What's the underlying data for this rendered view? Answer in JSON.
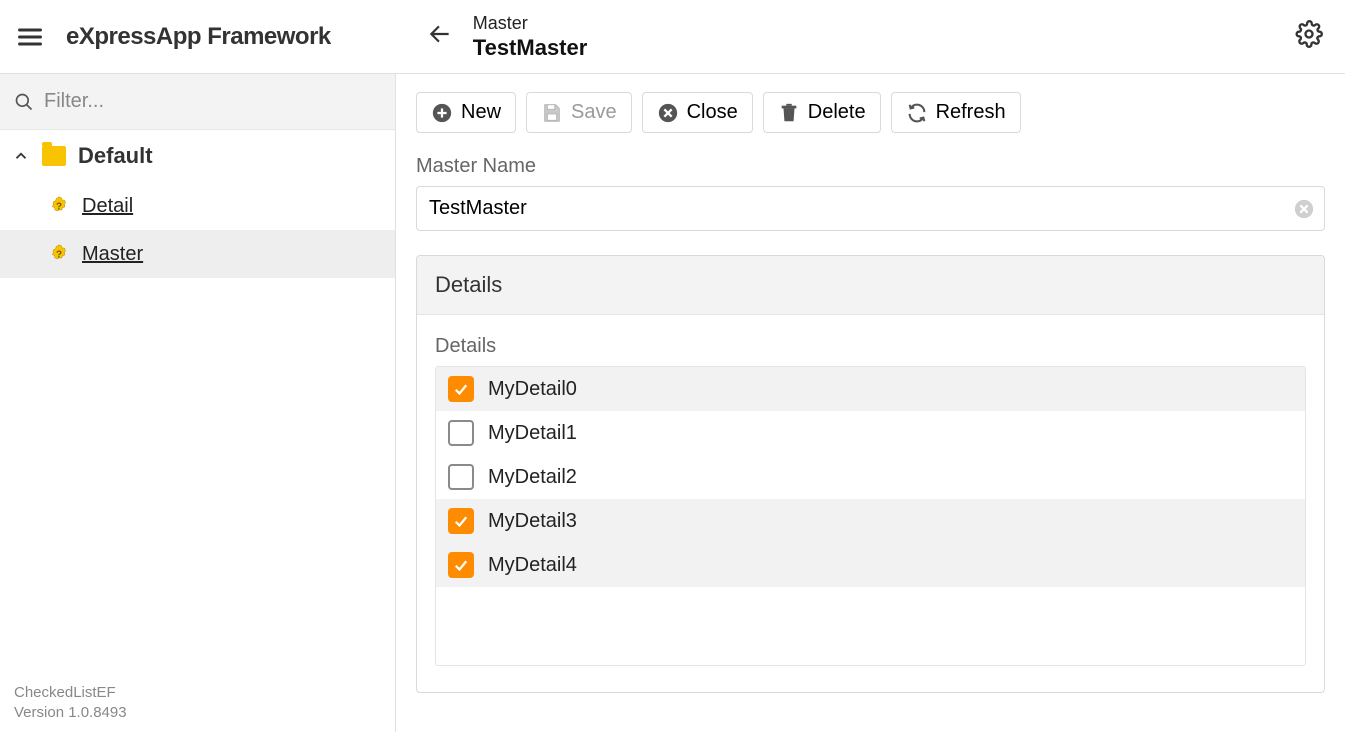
{
  "app": {
    "title": "eXpressApp Framework"
  },
  "breadcrumb": {
    "parent": "Master",
    "current": "TestMaster"
  },
  "sidebar": {
    "filter_placeholder": "Filter...",
    "group": "Default",
    "items": [
      {
        "label": "Detail",
        "selected": false
      },
      {
        "label": "Master",
        "selected": true
      }
    ],
    "footer_line1": "CheckedListEF",
    "footer_line2": "Version 1.0.8493"
  },
  "toolbar": {
    "new_label": "New",
    "save_label": "Save",
    "close_label": "Close",
    "delete_label": "Delete",
    "refresh_label": "Refresh"
  },
  "form": {
    "master_name_label": "Master Name",
    "master_name_value": "TestMaster"
  },
  "details_panel": {
    "header": "Details",
    "inner_label": "Details",
    "rows": [
      {
        "label": "MyDetail0",
        "checked": true
      },
      {
        "label": "MyDetail1",
        "checked": false
      },
      {
        "label": "MyDetail2",
        "checked": false
      },
      {
        "label": "MyDetail3",
        "checked": true
      },
      {
        "label": "MyDetail4",
        "checked": true
      }
    ]
  }
}
